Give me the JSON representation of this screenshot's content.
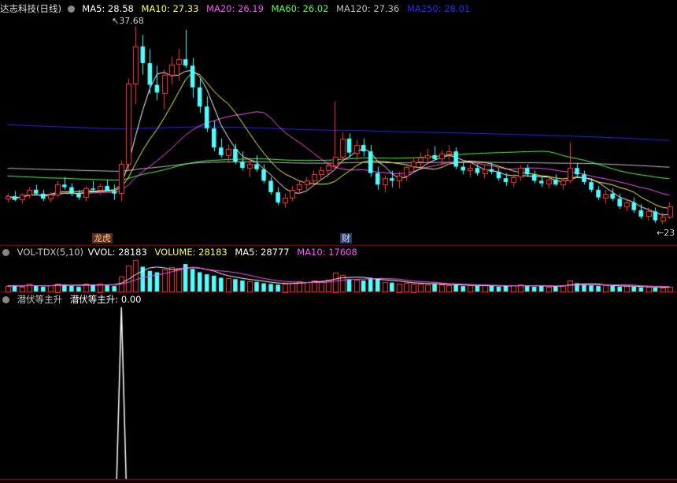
{
  "main_legend": {
    "title": "达志科技(日线)",
    "ma5": "MA5: 28.58",
    "ma10": "MA10: 27.33",
    "ma20": "MA20: 26.19",
    "ma60": "MA60: 26.02",
    "ma120": "MA120: 27.36",
    "ma250": "MA250: 28.01"
  },
  "vol_legend": {
    "title": "VOL-TDX(5,10)",
    "vvol": "VVOL: 28183",
    "volume": "VOLUME: 28183",
    "ma5": "MA5: 28777",
    "ma10": "MA10: 17608"
  },
  "ind_legend": {
    "title": "潜伏等主升",
    "value": "潜伏等主升: 0.00"
  },
  "colors": {
    "up": "#ff3a3a",
    "down": "#54fcfc",
    "ma5": "#ffffff",
    "ma10": "#ffff54",
    "ma20": "#ff54ff",
    "ma60": "#54ff54",
    "ma120": "#c0c0c0",
    "ma250": "#2828ff",
    "divider": "#a00000"
  },
  "chart_data": [
    {
      "type": "candlestick",
      "panel": "price",
      "annotations": {
        "high_label": "37.68",
        "low_label": "23",
        "tag_1": "龙虎",
        "tag_2": "财"
      },
      "ohlc_note": "approximate daily open/high/low/close read from chart (prices)",
      "candles": [
        [
          24.2,
          24.6,
          23.9,
          24.4
        ],
        [
          24.4,
          24.8,
          24.0,
          24.1
        ],
        [
          24.1,
          24.6,
          23.8,
          24.5
        ],
        [
          24.5,
          25.1,
          24.2,
          24.9
        ],
        [
          24.9,
          25.3,
          24.5,
          24.6
        ],
        [
          24.6,
          24.9,
          24.0,
          24.2
        ],
        [
          24.2,
          24.7,
          23.9,
          24.5
        ],
        [
          24.5,
          25.6,
          24.3,
          25.3
        ],
        [
          25.3,
          25.9,
          24.9,
          25.1
        ],
        [
          25.1,
          25.4,
          24.4,
          24.6
        ],
        [
          24.6,
          24.9,
          24.1,
          24.3
        ],
        [
          24.3,
          25.2,
          24.0,
          25.0
        ],
        [
          25.0,
          25.6,
          24.7,
          24.9
        ],
        [
          24.9,
          25.4,
          24.5,
          25.2
        ],
        [
          25.2,
          25.7,
          24.8,
          24.8
        ],
        [
          24.8,
          25.3,
          24.1,
          24.6
        ],
        [
          24.6,
          27.2,
          24.0,
          26.9
        ],
        [
          26.9,
          33.6,
          26.4,
          33.2
        ],
        [
          33.2,
          37.68,
          31.6,
          36.1
        ],
        [
          36.1,
          37.0,
          33.9,
          34.8
        ],
        [
          34.8,
          35.9,
          32.4,
          33.1
        ],
        [
          33.1,
          34.6,
          31.9,
          32.5
        ],
        [
          32.5,
          34.3,
          31.2,
          33.9
        ],
        [
          33.9,
          35.3,
          33.1,
          34.7
        ],
        [
          34.7,
          35.9,
          33.4,
          35.1
        ],
        [
          35.1,
          37.4,
          34.4,
          34.6
        ],
        [
          34.6,
          35.2,
          32.1,
          32.9
        ],
        [
          32.9,
          33.6,
          30.9,
          31.4
        ],
        [
          31.4,
          32.2,
          29.4,
          29.7
        ],
        [
          29.7,
          30.3,
          27.9,
          28.2
        ],
        [
          28.2,
          28.9,
          27.4,
          27.6
        ],
        [
          27.6,
          28.4,
          27.0,
          28.1
        ],
        [
          28.1,
          28.5,
          26.9,
          27.1
        ],
        [
          27.1,
          27.9,
          26.4,
          26.6
        ],
        [
          26.6,
          27.4,
          25.9,
          26.9
        ],
        [
          26.9,
          27.6,
          26.3,
          26.5
        ],
        [
          26.5,
          26.9,
          25.4,
          25.6
        ],
        [
          25.6,
          25.9,
          24.5,
          24.7
        ],
        [
          24.7,
          25.1,
          23.7,
          23.9
        ],
        [
          23.9,
          24.6,
          23.5,
          24.3
        ],
        [
          24.3,
          25.2,
          24.0,
          24.9
        ],
        [
          24.9,
          25.6,
          24.6,
          25.3
        ],
        [
          25.3,
          25.9,
          24.9,
          25.6
        ],
        [
          25.6,
          26.4,
          25.2,
          26.1
        ],
        [
          26.1,
          26.7,
          25.7,
          26.4
        ],
        [
          26.4,
          27.1,
          25.9,
          26.8
        ],
        [
          26.8,
          31.8,
          26.5,
          27.5
        ],
        [
          27.5,
          29.4,
          27.0,
          28.9
        ],
        [
          28.9,
          29.3,
          27.4,
          27.8
        ],
        [
          27.8,
          28.8,
          27.2,
          28.4
        ],
        [
          28.4,
          28.9,
          27.5,
          27.9
        ],
        [
          27.9,
          28.4,
          25.9,
          26.2
        ],
        [
          26.2,
          26.7,
          24.9,
          25.3
        ],
        [
          25.3,
          26.0,
          24.7,
          25.8
        ],
        [
          25.8,
          26.4,
          25.1,
          25.6
        ],
        [
          25.6,
          26.3,
          25.0,
          26.0
        ],
        [
          26.0,
          26.9,
          25.6,
          26.7
        ],
        [
          26.7,
          27.4,
          26.2,
          27.1
        ],
        [
          27.1,
          27.8,
          26.6,
          27.4
        ],
        [
          27.4,
          28.1,
          26.9,
          27.6
        ],
        [
          27.6,
          28.3,
          27.2,
          27.3
        ],
        [
          27.3,
          28.0,
          26.8,
          27.7
        ],
        [
          27.7,
          28.4,
          27.2,
          27.9
        ],
        [
          27.9,
          28.2,
          26.5,
          26.7
        ],
        [
          26.7,
          27.1,
          26.1,
          26.4
        ],
        [
          26.4,
          26.9,
          25.9,
          26.6
        ],
        [
          26.6,
          26.9,
          26.0,
          26.2
        ],
        [
          26.2,
          26.8,
          25.8,
          26.5
        ],
        [
          26.5,
          27.0,
          26.1,
          26.3
        ],
        [
          26.3,
          26.6,
          25.6,
          25.8
        ],
        [
          25.8,
          26.2,
          25.2,
          25.5
        ],
        [
          25.5,
          26.1,
          25.1,
          25.9
        ],
        [
          25.9,
          26.8,
          25.6,
          26.6
        ],
        [
          26.6,
          26.9,
          25.9,
          26.1
        ],
        [
          26.1,
          26.4,
          25.4,
          25.6
        ],
        [
          25.6,
          26.0,
          25.1,
          25.4
        ],
        [
          25.4,
          25.9,
          25.0,
          25.7
        ],
        [
          25.7,
          26.1,
          25.2,
          25.3
        ],
        [
          25.3,
          25.8,
          24.9,
          25.6
        ],
        [
          25.6,
          28.6,
          25.4,
          26.6
        ],
        [
          26.6,
          27.0,
          25.9,
          26.1
        ],
        [
          26.1,
          26.4,
          25.3,
          25.5
        ],
        [
          25.5,
          25.8,
          24.7,
          24.9
        ],
        [
          24.9,
          25.2,
          24.1,
          24.3
        ],
        [
          24.3,
          24.9,
          23.8,
          24.6
        ],
        [
          24.6,
          25.0,
          24.0,
          24.2
        ],
        [
          24.2,
          24.6,
          23.4,
          23.6
        ],
        [
          23.6,
          24.1,
          23.2,
          23.9
        ],
        [
          23.9,
          24.3,
          23.1,
          23.3
        ],
        [
          23.3,
          23.8,
          22.6,
          22.8
        ],
        [
          22.8,
          23.5,
          22.5,
          23.2
        ],
        [
          23.2,
          23.5,
          22.3,
          22.5
        ],
        [
          22.5,
          23.1,
          22.2,
          22.8
        ],
        [
          22.8,
          23.9,
          22.6,
          23.6
        ]
      ],
      "ma_labels": [
        "MA5",
        "MA10",
        "MA20",
        "MA60",
        "MA120",
        "MA250"
      ]
    },
    {
      "type": "bar",
      "panel": "volume",
      "series_name": "VOLUME",
      "values": [
        8,
        9,
        7,
        11,
        8,
        7,
        9,
        12,
        10,
        8,
        7,
        11,
        10,
        12,
        9,
        8,
        22,
        38,
        46,
        36,
        30,
        28,
        32,
        35,
        34,
        40,
        33,
        28,
        25,
        23,
        20,
        19,
        18,
        16,
        15,
        14,
        12,
        11,
        10,
        12,
        13,
        15,
        14,
        16,
        15,
        17,
        28,
        24,
        18,
        17,
        16,
        20,
        18,
        14,
        13,
        12,
        13,
        12,
        11,
        10,
        11,
        10,
        9,
        10,
        8,
        9,
        8,
        9,
        8,
        7,
        8,
        9,
        10,
        8,
        7,
        8,
        7,
        8,
        9,
        16,
        12,
        10,
        9,
        8,
        9,
        8,
        7,
        8,
        7,
        6,
        7,
        6,
        6,
        7
      ]
    },
    {
      "type": "line",
      "panel": "indicator",
      "series_name": "潜伏等主升",
      "spike_index": 16,
      "spike_value": 1,
      "ylim": [
        0,
        1
      ]
    }
  ]
}
